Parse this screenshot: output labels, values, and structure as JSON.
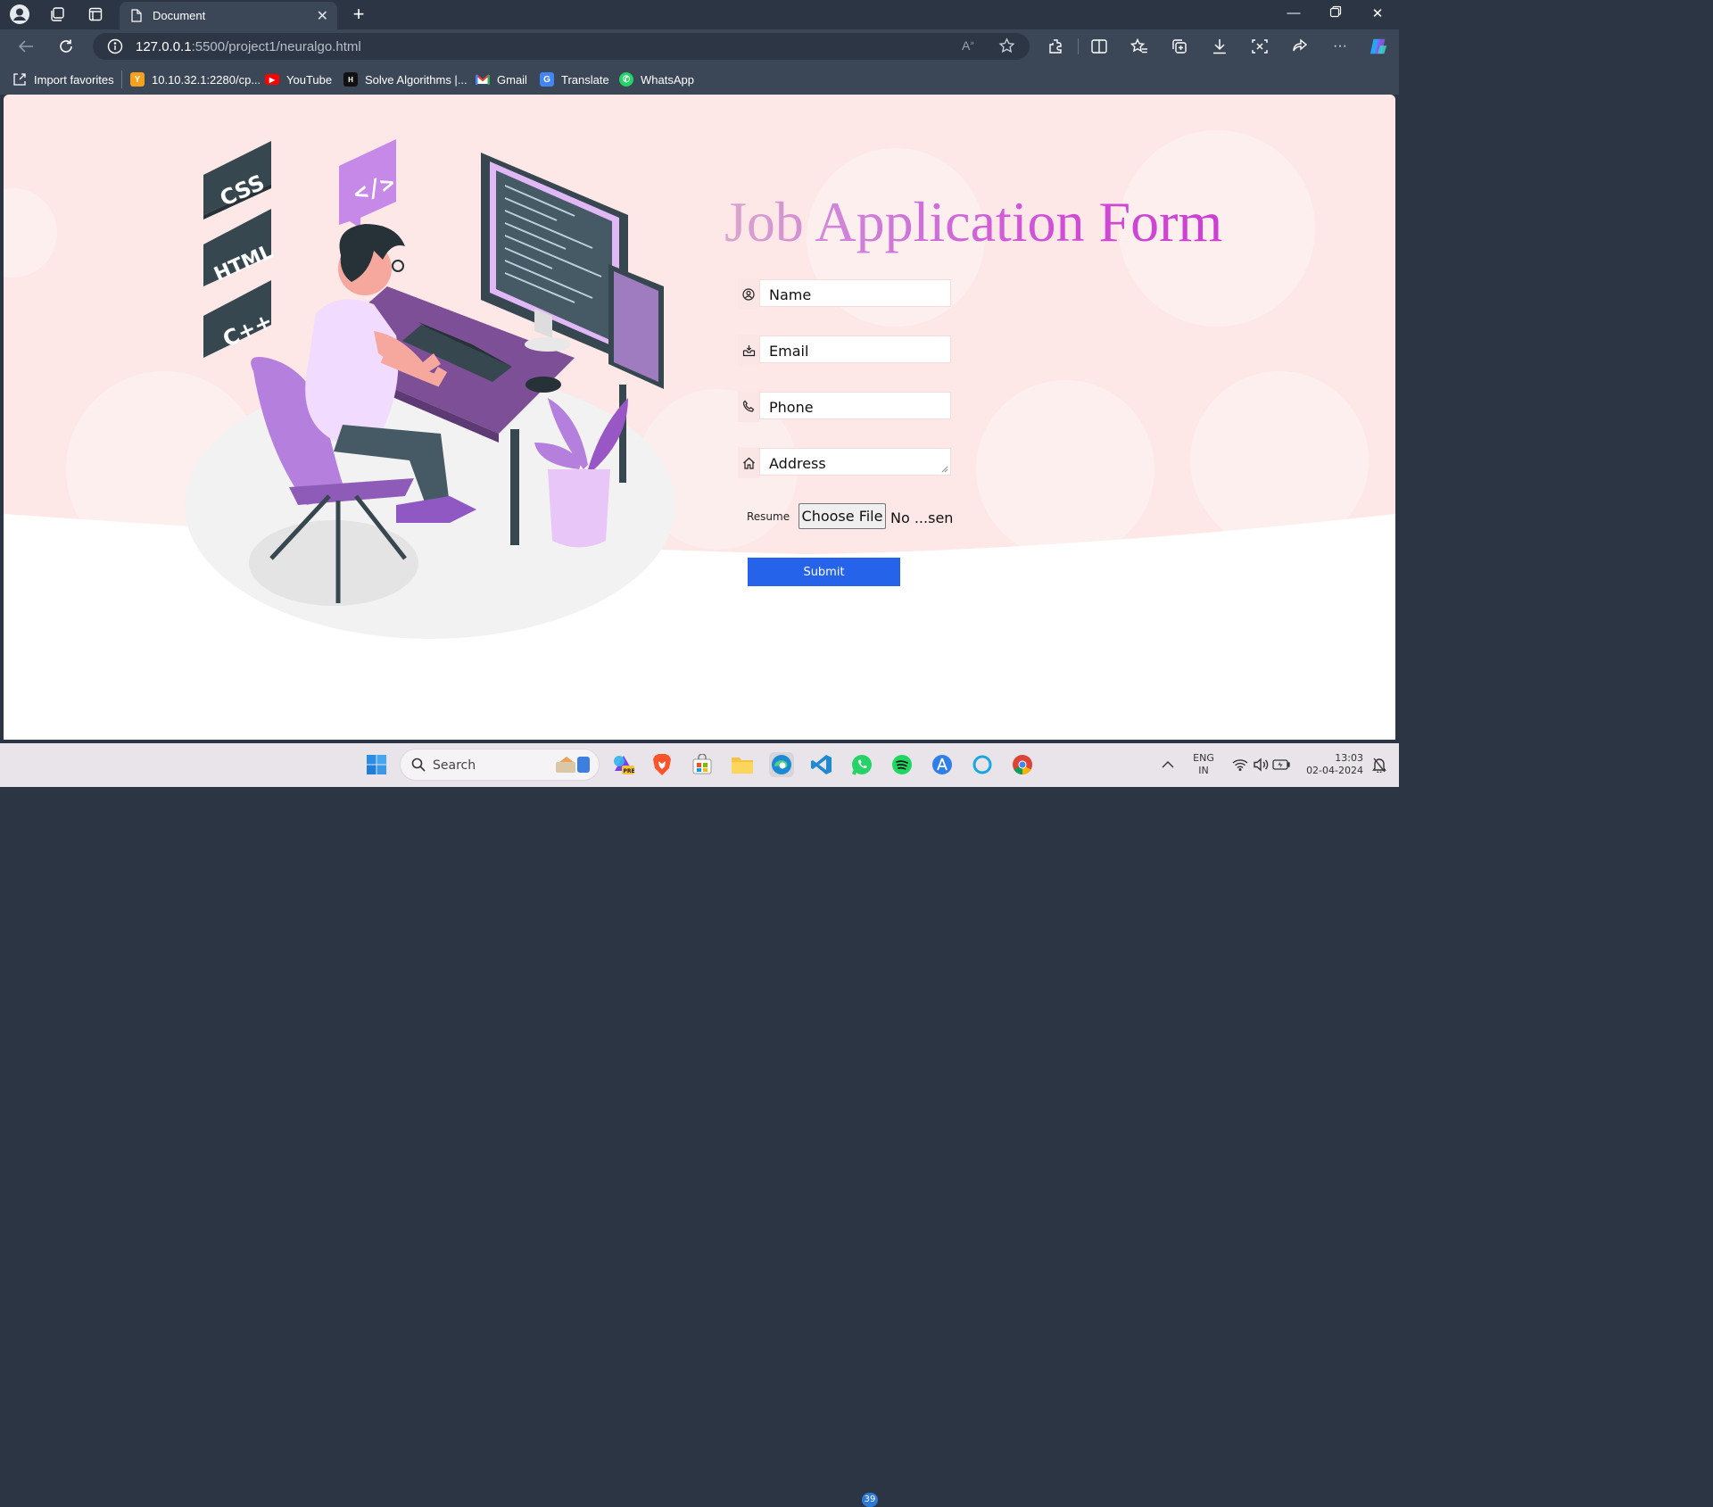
{
  "browser": {
    "tab_title": "Document",
    "url_host": "127.0.0.1",
    "url_path": ":5500/project1/neuralgo.html",
    "favorites": [
      {
        "label": "Import favorites"
      },
      {
        "label": "10.10.32.1:2280/cp..."
      },
      {
        "label": "YouTube"
      },
      {
        "label": "Solve Algorithms |..."
      },
      {
        "label": "Gmail"
      },
      {
        "label": "Translate"
      },
      {
        "label": "WhatsApp"
      }
    ]
  },
  "illustration": {
    "tags": [
      "CSS",
      "HTML",
      "C++",
      "</>"
    ]
  },
  "form": {
    "title": "Job Application Form",
    "fields": [
      {
        "label": "Name",
        "icon": "user-circle-icon"
      },
      {
        "label": "Email",
        "icon": "inbox-icon"
      },
      {
        "label": "Phone",
        "icon": "phone-icon"
      },
      {
        "label": "Address",
        "icon": "home-icon"
      }
    ],
    "resume_label": "Resume",
    "choose_file_label": "Choose File",
    "file_status": "No ...sen",
    "submit_label": "Submit"
  },
  "colors": {
    "accent_submit": "#2563eb",
    "title_gradient_start": "#d9a7cc",
    "title_gradient_end": "#cc3fd1",
    "page_pink": "#fde7e7"
  },
  "taskbar": {
    "search_label": "Search",
    "whatsapp_badge": "39",
    "lang_line1": "ENG",
    "lang_line2": "IN",
    "time": "13:03",
    "date": "02-04-2024"
  }
}
